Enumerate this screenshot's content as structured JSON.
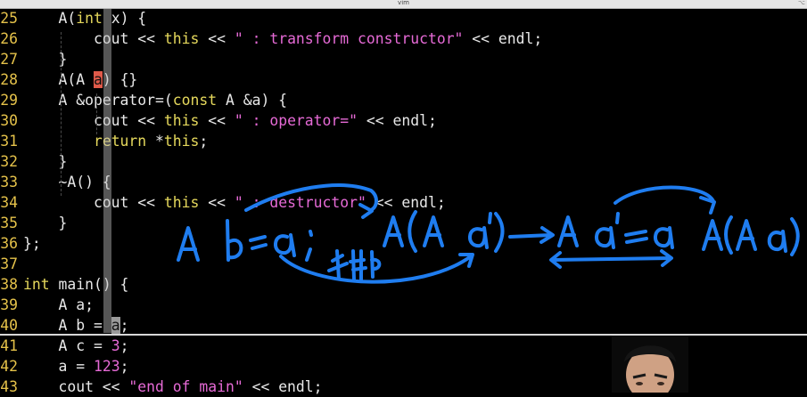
{
  "window": {
    "title": "vim",
    "corner": "⌥"
  },
  "code_lines": [
    {
      "num": "25",
      "tokens": [
        [
          "t",
          "    A("
        ],
        [
          "kw",
          "int"
        ],
        [
          "t",
          " x) {"
        ]
      ]
    },
    {
      "num": "26",
      "tokens": [
        [
          "t",
          "        cout << "
        ],
        [
          "kw",
          "this"
        ],
        [
          "t",
          " << "
        ],
        [
          "pk",
          "\" : transform constructor\""
        ],
        [
          "t",
          " << endl;"
        ]
      ]
    },
    {
      "num": "27",
      "tokens": [
        [
          "t",
          "    }"
        ]
      ]
    },
    {
      "num": "28",
      "tokens": [
        [
          "t",
          "    A(A "
        ],
        [
          "cur",
          "a"
        ],
        [
          "t",
          ") {}"
        ]
      ]
    },
    {
      "num": "29",
      "tokens": [
        [
          "t",
          "    A &operator=("
        ],
        [
          "kw",
          "const"
        ],
        [
          "t",
          " A &a) {"
        ]
      ]
    },
    {
      "num": "30",
      "tokens": [
        [
          "t",
          "        cout << "
        ],
        [
          "kw",
          "this"
        ],
        [
          "t",
          " << "
        ],
        [
          "pk",
          "\" : operator=\""
        ],
        [
          "t",
          " << endl;"
        ]
      ]
    },
    {
      "num": "31",
      "tokens": [
        [
          "t",
          "        "
        ],
        [
          "kw",
          "return"
        ],
        [
          "t",
          " *"
        ],
        [
          "kw",
          "this"
        ],
        [
          "t",
          ";"
        ]
      ]
    },
    {
      "num": "32",
      "tokens": [
        [
          "t",
          "    }"
        ]
      ]
    },
    {
      "num": "33",
      "tokens": [
        [
          "t",
          "    ~A() {"
        ]
      ]
    },
    {
      "num": "34",
      "tokens": [
        [
          "t",
          "        cout << "
        ],
        [
          "kw",
          "this"
        ],
        [
          "t",
          " << "
        ],
        [
          "pk",
          "\" : destructor\""
        ],
        [
          "t",
          " << endl;"
        ]
      ]
    },
    {
      "num": "35",
      "tokens": [
        [
          "t",
          "    }"
        ]
      ]
    },
    {
      "num": "36",
      "tokens": [
        [
          "t",
          "};"
        ]
      ]
    },
    {
      "num": "37",
      "tokens": []
    },
    {
      "num": "38",
      "tokens": [
        [
          "kw",
          "int"
        ],
        [
          "t",
          " main() {"
        ]
      ]
    },
    {
      "num": "39",
      "tokens": [
        [
          "t",
          "    A a;"
        ]
      ]
    },
    {
      "num": "40",
      "tokens": [
        [
          "t",
          "    A b = "
        ],
        [
          "cur2",
          "a"
        ],
        [
          "t",
          ";"
        ]
      ]
    },
    {
      "num": "41",
      "tokens": [
        [
          "t",
          "    A c = "
        ],
        [
          "num",
          "3"
        ],
        [
          "t",
          ";"
        ]
      ]
    },
    {
      "num": "42",
      "tokens": [
        [
          "t",
          "    a = "
        ],
        [
          "num",
          "123"
        ],
        [
          "t",
          ";"
        ]
      ]
    },
    {
      "num": "43",
      "tokens": [
        [
          "t",
          "    cout << "
        ],
        [
          "pk",
          "\"end of main\""
        ],
        [
          "t",
          " << endl;"
        ]
      ]
    }
  ],
  "colors": {
    "keyword": "#e5d85c",
    "string": "#e66ad6",
    "line_number": "#e5c24a",
    "annotation_ink": "#1f7df0",
    "cursor": "#e05a4a"
  }
}
